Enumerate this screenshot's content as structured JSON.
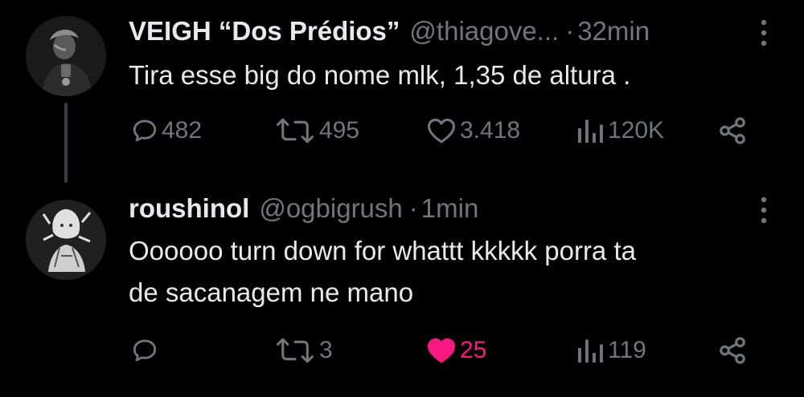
{
  "colors": {
    "background": "#000000",
    "primary_text": "#e7e9ea",
    "secondary_text": "#71767b",
    "like_active": "#f91880",
    "thread_line": "#3a3d41"
  },
  "tweets": [
    {
      "display_name": "VEIGH “Dos Prédios”",
      "handle": "@thiagove...",
      "separator": "·",
      "time": "32min",
      "text_lines": [
        "Tira esse big do nome mlk, 1,35 de altura ."
      ],
      "actions": {
        "reply_count": "482",
        "retweet_count": "495",
        "like_count": "3.418",
        "view_count": "120K",
        "liked": false
      },
      "icons": [
        "reply-icon",
        "retweet-icon",
        "like-icon",
        "views-icon",
        "share-icon",
        "more-icon"
      ]
    },
    {
      "display_name": "roushinol",
      "handle": "@ogbigrush",
      "separator": "·",
      "time": "1min",
      "text_lines": [
        "Oooooo turn down for whattt kkkkk porra ta",
        "de sacanagem ne mano"
      ],
      "actions": {
        "reply_count": "",
        "retweet_count": "3",
        "like_count": "25",
        "view_count": "119",
        "liked": true
      },
      "icons": [
        "reply-icon",
        "retweet-icon",
        "like-icon",
        "views-icon",
        "share-icon",
        "more-icon"
      ]
    }
  ]
}
